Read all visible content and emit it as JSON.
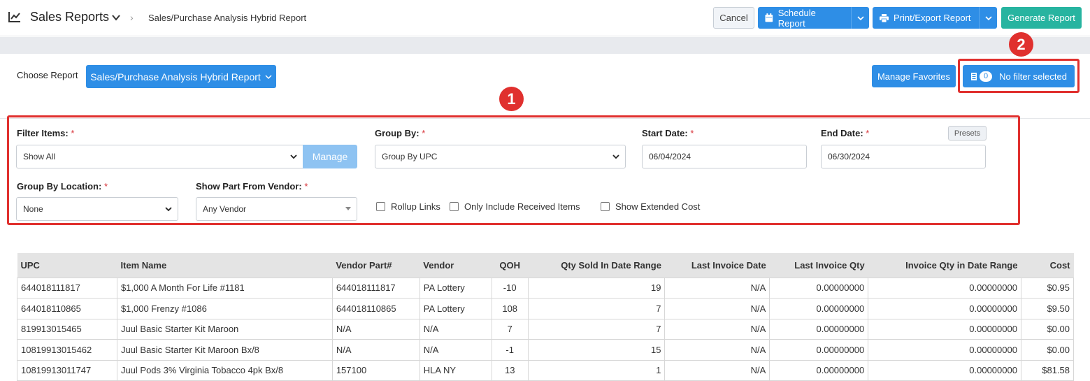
{
  "header": {
    "icon": "line-chart-icon",
    "title": "Sales Reports",
    "breadcrumb": "Sales/Purchase Analysis Hybrid Report",
    "buttons": {
      "cancel": "Cancel",
      "schedule": "Schedule Report",
      "print_export": "Print/Export Report",
      "generate": "Generate Report"
    }
  },
  "report_bar": {
    "choose_label": "Choose Report",
    "selected_report": "Sales/Purchase Analysis Hybrid Report",
    "manage_favorites": "Manage Favorites",
    "filter_count": "0",
    "filter_text": "No filter selected"
  },
  "markers": [
    "1",
    "2"
  ],
  "filters": {
    "filter_items": {
      "label": "Filter Items:",
      "value": "Show All",
      "manage": "Manage"
    },
    "group_by": {
      "label": "Group By:",
      "value": "Group By UPC"
    },
    "start_date": {
      "label": "Start Date:",
      "value": "06/04/2024"
    },
    "end_date": {
      "label": "End Date:",
      "value": "06/30/2024",
      "presets": "Presets"
    },
    "group_by_location": {
      "label": "Group By Location:",
      "value": "None"
    },
    "show_part_from_vendor": {
      "label": "Show Part From Vendor:",
      "value": "Any Vendor"
    },
    "required_mark": "*",
    "checkboxes": {
      "rollup_links": "Rollup Links",
      "only_received": "Only Include Received Items",
      "show_extended_cost": "Show Extended Cost"
    }
  },
  "table": {
    "columns": [
      "UPC",
      "Item Name",
      "Vendor Part#",
      "Vendor",
      "QOH",
      "Qty Sold In Date Range",
      "Last Invoice Date",
      "Last Invoice Qty",
      "Invoice Qty in Date Range",
      "Cost"
    ],
    "rows": [
      [
        "644018111817",
        "$1,000 A Month For Life #1181",
        "644018111817",
        "PA Lottery",
        "-10",
        "19",
        "N/A",
        "0.00000000",
        "0.00000000",
        "$0.95"
      ],
      [
        "644018110865",
        "$1,000 Frenzy #1086",
        "644018110865",
        "PA Lottery",
        "108",
        "7",
        "N/A",
        "0.00000000",
        "0.00000000",
        "$9.50"
      ],
      [
        "819913015465",
        "Juul Basic Starter Kit Maroon",
        "N/A",
        "N/A",
        "7",
        "7",
        "N/A",
        "0.00000000",
        "0.00000000",
        "$0.00"
      ],
      [
        "10819913015462",
        "Juul Basic Starter Kit Maroon Bx/8",
        "N/A",
        "N/A",
        "-1",
        "15",
        "N/A",
        "0.00000000",
        "0.00000000",
        "$0.00"
      ],
      [
        "10819913011747",
        "Juul Pods 3% Virginia Tobacco 4pk Bx/8",
        "157100",
        "HLA NY",
        "13",
        "1",
        "N/A",
        "0.00000000",
        "0.00000000",
        "$81.58"
      ]
    ]
  }
}
